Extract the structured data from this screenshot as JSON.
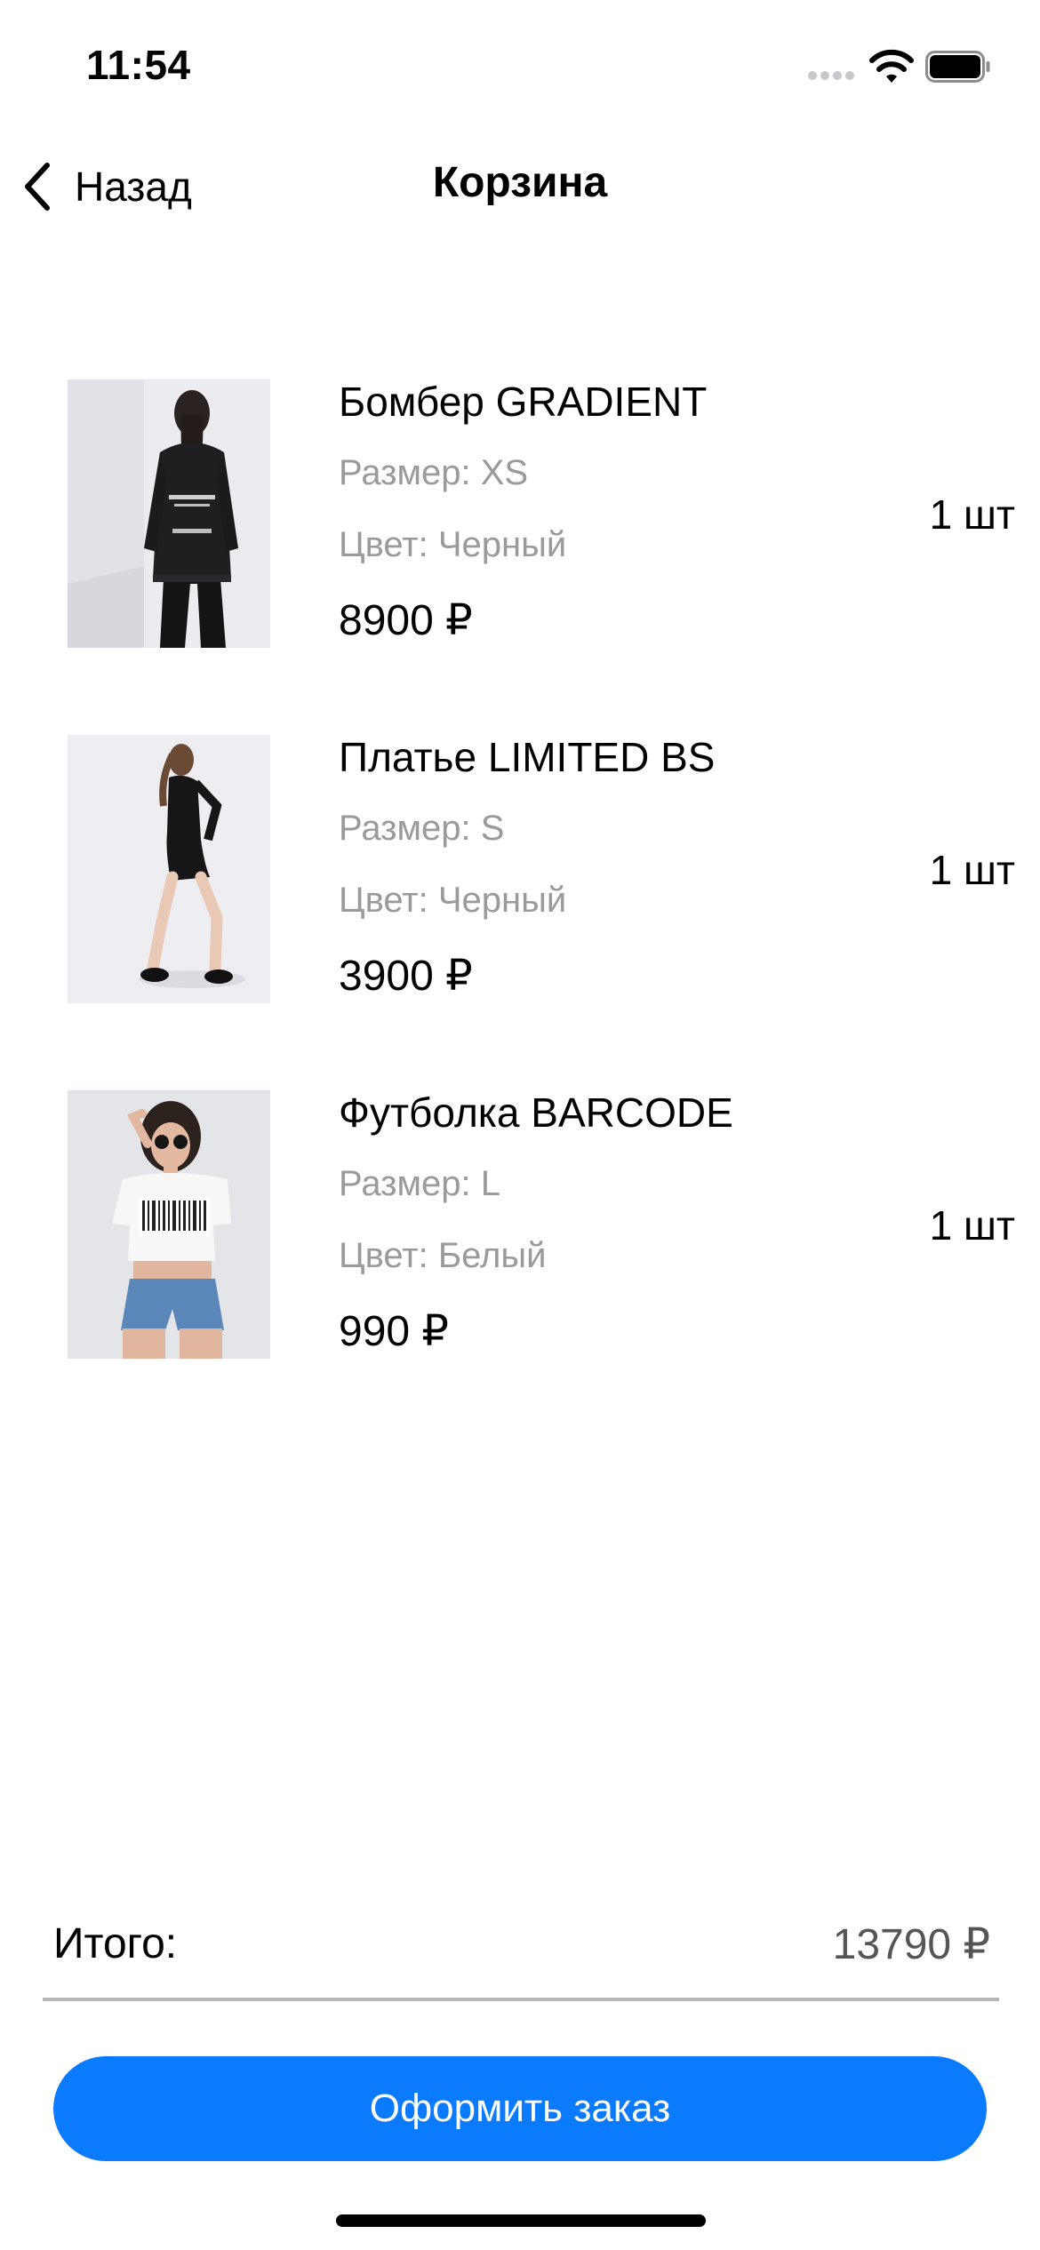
{
  "status_bar": {
    "time": "11:54"
  },
  "nav": {
    "back_label": "Назад",
    "title": "Корзина"
  },
  "cart_items": [
    {
      "name": "Бомбер GRADIENT",
      "size": "Размер: XS",
      "color": "Цвет: Черный",
      "price": "8900 ₽",
      "quantity": "1 шт",
      "image": "woman-in-black-bomber-jacket"
    },
    {
      "name": "Платье LIMITED BS",
      "size": "Размер: S",
      "color": "Цвет: Черный",
      "price": "3900 ₽",
      "quantity": "1 шт",
      "image": "woman-in-black-dress"
    },
    {
      "name": "Футболка BARCODE",
      "size": "Размер: L",
      "color": "Цвет: Белый",
      "price": "990 ₽",
      "quantity": "1 шт",
      "image": "woman-in-white-barcode-tshirt"
    }
  ],
  "total": {
    "label": "Итого:",
    "value": "13790 ₽"
  },
  "checkout": {
    "label": "Оформить заказ"
  },
  "colors": {
    "accent": "#0a7aff",
    "secondary_text": "#9a9a9a",
    "divider": "#b6b6b6"
  }
}
